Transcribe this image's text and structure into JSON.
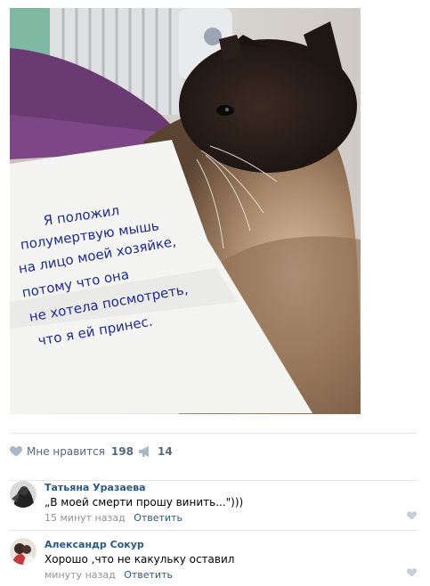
{
  "photo": {
    "note_lines": [
      "Я положил",
      "полумертвую мышь",
      "на лицо моей хозяйке,",
      "потому что она",
      "не хотела посмотреть,",
      "что я ей принес."
    ]
  },
  "actions": {
    "like_label": "Мне нравится",
    "like_count": "198",
    "share_count": "14"
  },
  "comments": [
    {
      "author": "Татьяна Уразаева",
      "text": "„В моей смерти прошу винить...\")))",
      "time": "15 минут назад",
      "reply": "Ответить"
    },
    {
      "author": "Александр Сокур",
      "text": "Хорошо ,что не какульку оставил",
      "time": "минуту назад",
      "reply": "Ответить"
    }
  ],
  "colors": {
    "link": "#2a5885",
    "muted": "#55677d",
    "gray": "#939393",
    "divider": "#e7e8ec"
  },
  "icons": [
    "heart-icon",
    "megaphone-icon",
    "heart-icon"
  ]
}
